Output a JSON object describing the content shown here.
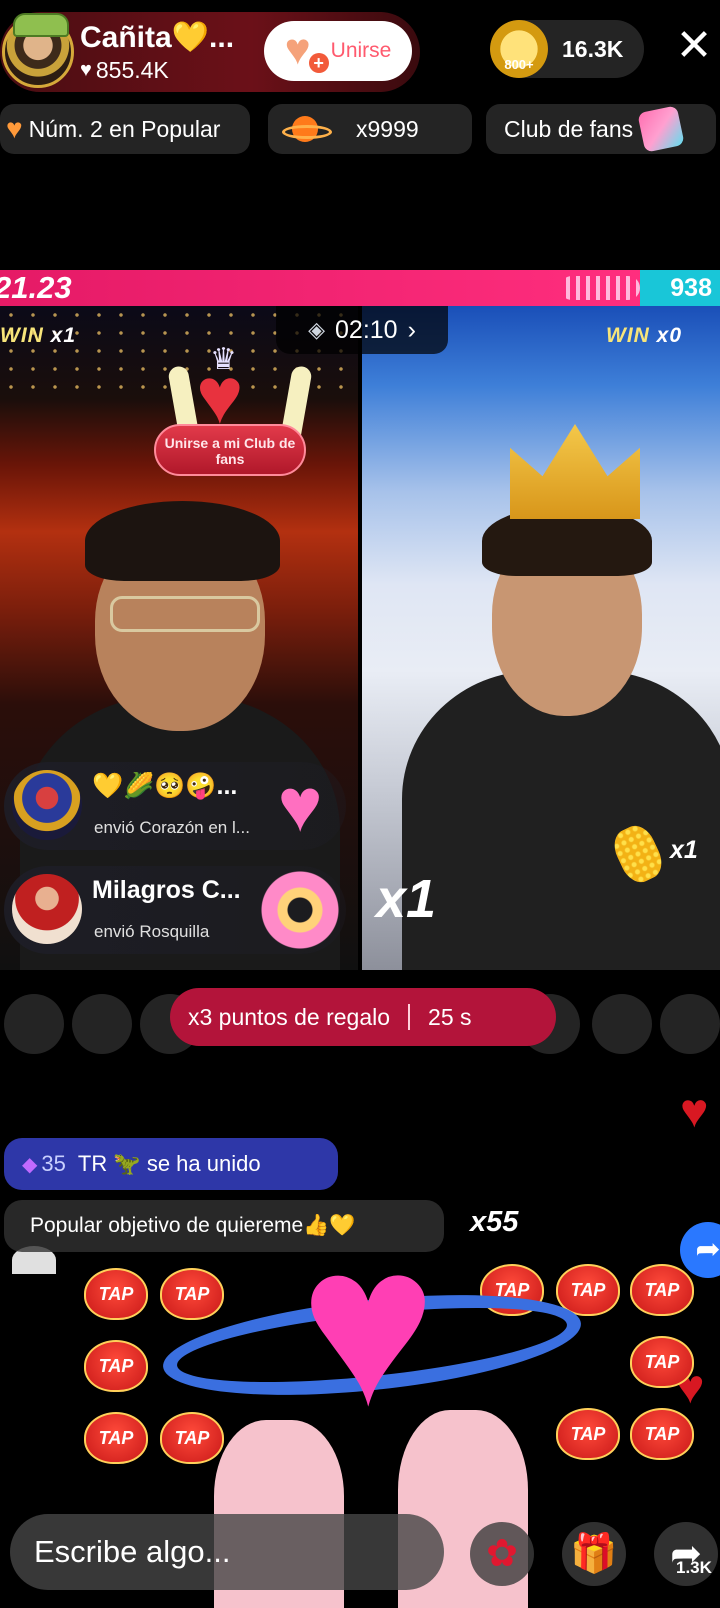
{
  "header": {
    "host_name": "Cañita💛...",
    "host_likes": "855.4K",
    "join_label": "Unirse",
    "coins_badge": "800+",
    "viewer_count": "16.3K"
  },
  "pills": {
    "popular_rank": "Núm. 2 en Popular",
    "multiplier": "x9999",
    "fan_club": "Club de fans"
  },
  "battle": {
    "left_score": "21.23",
    "right_score": "938",
    "timer": "02:10",
    "left_win_label": "WIN",
    "left_win_count": "x1",
    "right_win_label": "WIN",
    "right_win_count": "x0",
    "club_badge_text": "Unirse a mi Club de fans",
    "right_combo_big": "x1",
    "right_combo_small": "x1"
  },
  "gift_notifications": [
    {
      "title": "💛🌽🥺🤪...",
      "action": "envió",
      "gift": "Corazón en l..."
    },
    {
      "title": "Milagros C...",
      "action": "envió",
      "gift": "Rosquilla"
    }
  ],
  "points_banner": {
    "text": "x3 puntos de regalo",
    "countdown": "25 s"
  },
  "chat": {
    "join_level": "35",
    "join_message": "TR 🦖 se ha unido",
    "popular_message": "Popular objetivo de quiereme👍💛",
    "combo": "x55"
  },
  "tap_label": "TAP",
  "bottom": {
    "comment_placeholder": "Escribe algo...",
    "share_count": "1.3K"
  },
  "colors": {
    "battle_red": "#e51a66",
    "battle_blue": "#19c6d8",
    "join_chat_bg": "#2e37a8",
    "points_banner_bg": "#b3143a"
  }
}
